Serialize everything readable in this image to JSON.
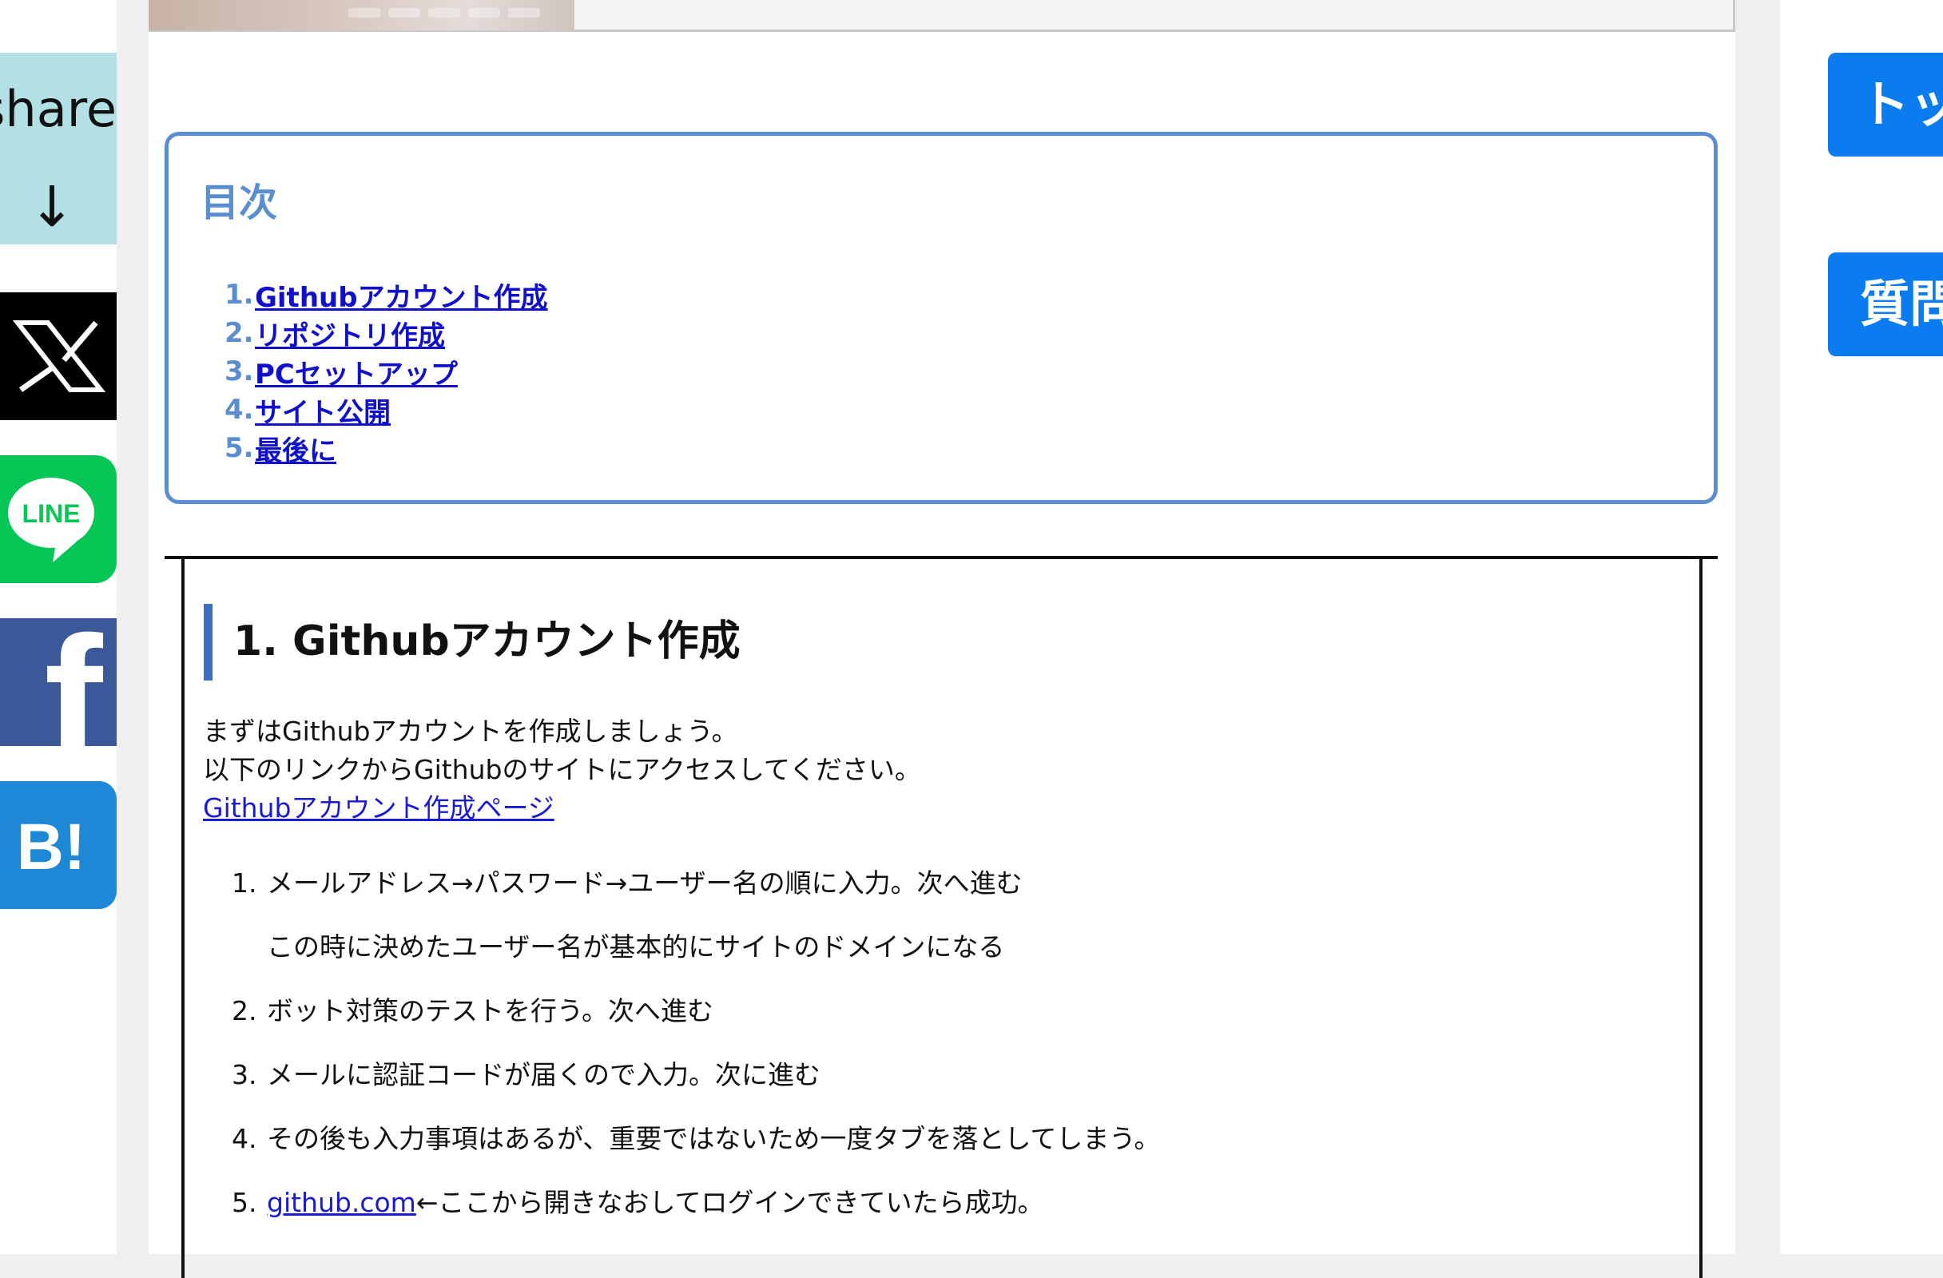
{
  "share": {
    "label": "share",
    "arrow": "↓",
    "buttons": [
      {
        "name": "X",
        "icon": "x-logo-icon",
        "color": "#000000"
      },
      {
        "name": "LINE",
        "icon": "line-logo-icon",
        "color": "#06c755",
        "text": "LINE"
      },
      {
        "name": "Facebook",
        "icon": "facebook-logo-icon",
        "color": "#3b5998",
        "text": "f"
      },
      {
        "name": "Hatena Bookmark",
        "icon": "hatena-bookmark-icon",
        "color": "#1e88d7",
        "text": "B!"
      }
    ]
  },
  "toc": {
    "title": "目次",
    "items": [
      {
        "num": "1.",
        "label": "Githubアカウント作成"
      },
      {
        "num": "2.",
        "label": "リポジトリ作成"
      },
      {
        "num": "3.",
        "label": "PCセットアップ"
      },
      {
        "num": "4.",
        "label": "サイト公開"
      },
      {
        "num": "5.",
        "label": "最後に"
      }
    ]
  },
  "section1": {
    "heading": "1. Githubアカウント作成",
    "paragraph_lines": [
      "まずはGithubアカウントを作成しましょう。",
      "以下のリンクからGithubのサイトにアクセスしてください。"
    ],
    "link_label": "Githubアカウント作成ページ",
    "steps": [
      {
        "num": "1.",
        "text": "メールアドレス→パスワード→ユーザー名の順に入力。次へ進む"
      },
      {
        "num": "",
        "text": "この時に決めたユーザー名が基本的にサイトのドメインになる"
      },
      {
        "num": "2.",
        "text": "ボット対策のテストを行う。次へ進む"
      },
      {
        "num": "3.",
        "text": "メールに認証コードが届くので入力。次に進む"
      },
      {
        "num": "4.",
        "text": "その後も入力事項はあるが、重要ではないため一度タブを落としてしまう。"
      },
      {
        "num": "5.",
        "link": "github.com",
        "text": "←ここから開きなおしてログインできていたら成功。"
      }
    ]
  },
  "right": {
    "top_button": "トップへ",
    "question_button": "質問"
  },
  "colors": {
    "toc_accent": "#5b8ed0",
    "link": "#1010cc",
    "right_button": "#0a7cf0",
    "share_box": "#b3e0e5"
  }
}
